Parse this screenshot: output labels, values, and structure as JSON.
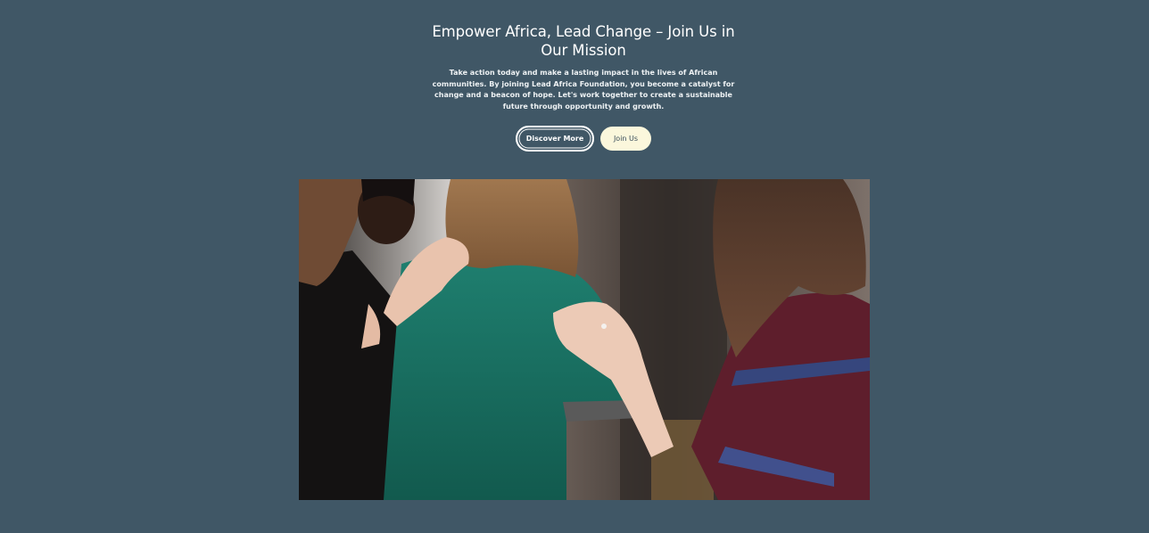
{
  "hero": {
    "title": "Empower Africa, Lead Change – Join Us in Our Mission",
    "description": "Take action today and make a lasting impact in the lives of African communities. By joining Lead Africa Foundation, you become a catalyst for change and a beacon of hope. Let's work together to create a sustainable future through opportunity and growth.",
    "buttons": {
      "discover_label": "Discover More",
      "join_label": "Join Us"
    }
  },
  "colors": {
    "page_background": "#405766",
    "text": "#ffffff",
    "join_button_background": "#fbf7dc",
    "join_button_text": "#3c4f5b"
  },
  "image": {
    "subject": "women gathered with hands on a shoulder in support"
  }
}
